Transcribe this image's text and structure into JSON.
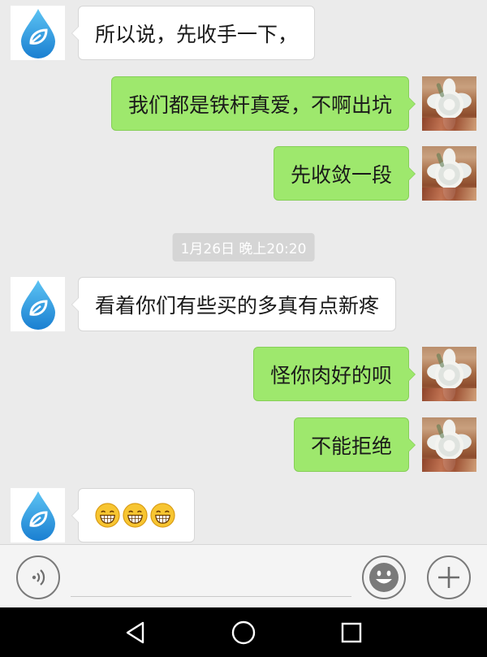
{
  "messages": [
    {
      "side": "left",
      "avatar": "water-drop-avatar",
      "text": "所以说，先收手一下，"
    },
    {
      "side": "right",
      "avatar": "succulent-avatar",
      "text": "我们都是铁杆真爱，不啊出坑"
    },
    {
      "side": "right",
      "avatar": "succulent-avatar",
      "text": "先收敛一段"
    },
    {
      "side": "left",
      "avatar": "water-drop-avatar",
      "text": "看着你们有些买的多真有点新疼"
    },
    {
      "side": "right",
      "avatar": "succulent-avatar",
      "text": "怪你肉好的呗"
    },
    {
      "side": "right",
      "avatar": "succulent-avatar",
      "text": "不能拒绝"
    },
    {
      "side": "left",
      "avatar": "water-drop-avatar",
      "emoji": [
        "grinning-face-icon",
        "grinning-face-icon",
        "grinning-face-icon"
      ]
    }
  ],
  "timestamp": "1月26日 晚上20:20",
  "composer": {
    "voice_icon": "voice-icon",
    "emoji_icon": "smiley-icon",
    "more_icon": "plus-icon",
    "input_value": "",
    "input_placeholder": ""
  },
  "navbar": {
    "back_icon": "back-triangle-icon",
    "home_icon": "home-circle-icon",
    "recent_icon": "recent-apps-square-icon"
  },
  "colors": {
    "background": "#ebebeb",
    "sent_bubble": "#9ee86d",
    "received_bubble": "#ffffff",
    "timestamp_bg": "#d5d5d5",
    "navbar": "#000000"
  }
}
